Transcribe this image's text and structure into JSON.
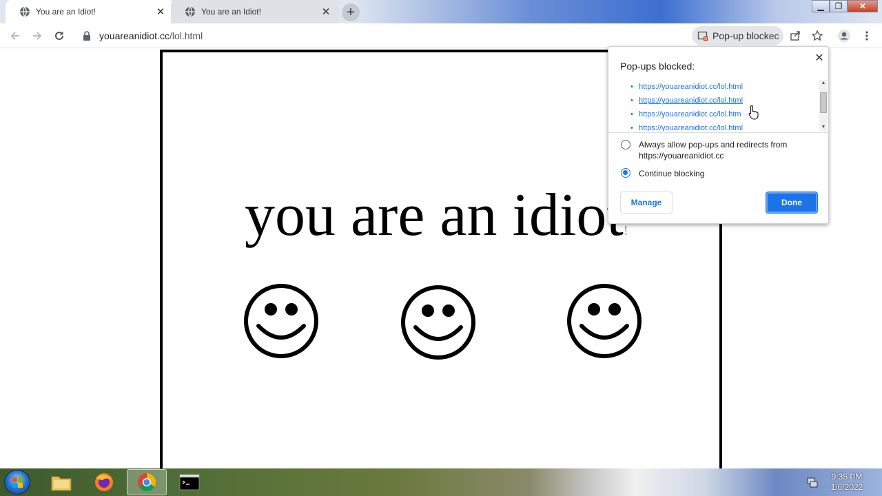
{
  "tabs": [
    {
      "title": "You are an Idiot!",
      "active": true
    },
    {
      "title": "You are an Idiot!",
      "active": false
    }
  ],
  "toolbar": {
    "url_host": "youareanidiot.cc",
    "url_path": "/lol.html",
    "popup_chip_label": "Pop-up blockec"
  },
  "page": {
    "headline": "you are an idiot",
    "headline_tail": "!",
    "smiley_count": 3
  },
  "popup": {
    "title": "Pop-ups blocked:",
    "blocked_urls": [
      "https://youareanidiot.cc/lol.html",
      "https://youareanidiot.cc/lol.html",
      "https://youareanidiot.cc/lol.htm",
      "https://youareanidiot.cc/lol.html"
    ],
    "option_allow": "Always allow pop-ups and redirects from https://youareanidiot.cc",
    "option_block": "Continue blocking",
    "selected_option": "Continue blocking",
    "manage_label": "Manage",
    "done_label": "Done"
  },
  "taskbar": {
    "time": "9:35 PM",
    "date": "1/6/2022",
    "apps": [
      "file-explorer",
      "firefox",
      "chrome",
      "command-prompt"
    ],
    "active_app": "chrome"
  },
  "colors": {
    "link": "#1a73e8",
    "accent": "#1a73e8",
    "tab_bar": "#dee1e6"
  }
}
